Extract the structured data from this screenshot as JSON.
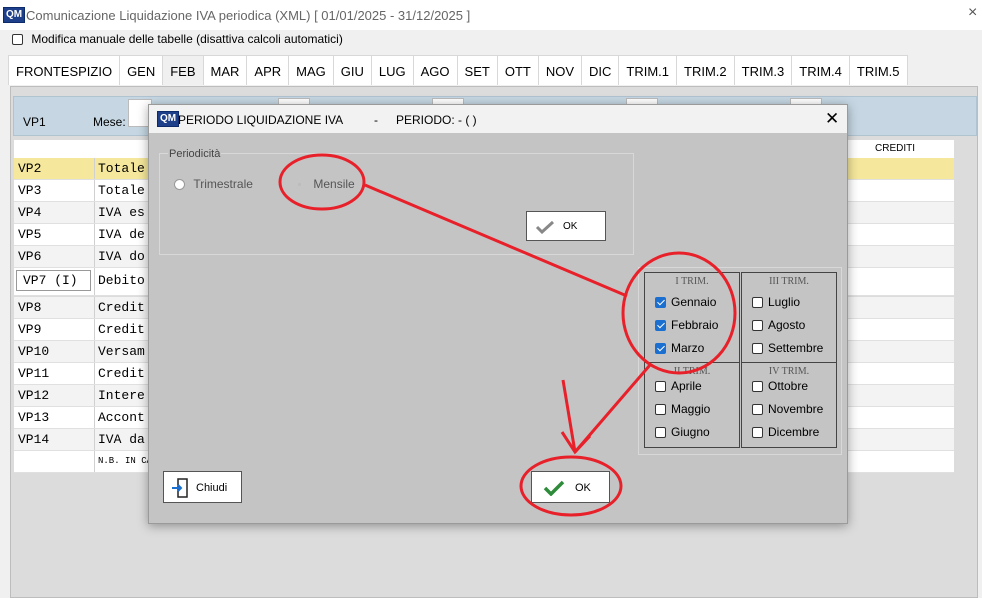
{
  "window": {
    "title": "Comunicazione Liquidazione IVA periodica (XML)  [ 01/01/2025 - 31/12/2025 ]",
    "logo": "QM",
    "close_icon": "×"
  },
  "manual_edit": {
    "label": "Modifica manuale delle tabelle (disattiva calcoli automatici)",
    "checked": false
  },
  "tabs": [
    "FRONTESPIZIO",
    "GEN",
    "FEB",
    "MAR",
    "APR",
    "MAG",
    "GIU",
    "LUG",
    "AGO",
    "SET",
    "OTT",
    "NOV",
    "DIC",
    "TRIM.1",
    "TRIM.2",
    "TRIM.3",
    "TRIM.4",
    "TRIM.5"
  ],
  "active_tab": "FEB",
  "vp1": {
    "code": "VP1",
    "mese_label": "Mese:"
  },
  "grid": {
    "crediti_header": "CREDITI",
    "rows": [
      {
        "code": "VP2",
        "desc": "Totale"
      },
      {
        "code": "VP3",
        "desc": "Totale"
      },
      {
        "code": "VP4",
        "desc": "IVA es"
      },
      {
        "code": "VP5",
        "desc": "IVA de"
      },
      {
        "code": "VP6",
        "desc": "IVA do"
      },
      {
        "code": "VP7 (I)",
        "desc": "Debito"
      },
      {
        "code": "VP8",
        "desc": "Credit"
      },
      {
        "code": "VP9",
        "desc": "Credit"
      },
      {
        "code": "VP10",
        "desc": "Versam"
      },
      {
        "code": "VP11",
        "desc": "Credit"
      },
      {
        "code": "VP12",
        "desc": "Intere"
      },
      {
        "code": "VP13",
        "desc": "Accont"
      },
      {
        "code": "VP14",
        "desc": "IVA da"
      },
      {
        "code": "",
        "desc": "N.B. IN CA"
      }
    ]
  },
  "dialog": {
    "title": "PERIODO LIQUIDAZIONE IVA",
    "dash": "-",
    "periodo": "PERIODO: -  ( )",
    "periodicita_label": "Periodicità",
    "trimestrale": "Trimestrale",
    "mensile": "Mensile",
    "selected_periodicity": "Mensile",
    "ok_small": "OK",
    "ok_main": "OK",
    "chiudi": "Chiudi",
    "quarters": [
      {
        "name": "I TRIM.",
        "months": [
          {
            "label": "Gennaio",
            "checked": true
          },
          {
            "label": "Febbraio",
            "checked": true
          },
          {
            "label": "Marzo",
            "checked": true
          }
        ]
      },
      {
        "name": "III TRIM.",
        "months": [
          {
            "label": "Luglio",
            "checked": false
          },
          {
            "label": "Agosto",
            "checked": false
          },
          {
            "label": "Settembre",
            "checked": false
          }
        ]
      },
      {
        "name": "II TRIM.",
        "months": [
          {
            "label": "Aprile",
            "checked": false
          },
          {
            "label": "Maggio",
            "checked": false
          },
          {
            "label": "Giugno",
            "checked": false
          }
        ]
      },
      {
        "name": "IV TRIM.",
        "months": [
          {
            "label": "Ottobre",
            "checked": false
          },
          {
            "label": "Novembre",
            "checked": false
          },
          {
            "label": "Dicembre",
            "checked": false
          }
        ]
      }
    ]
  },
  "colors": {
    "annotation": "#e8202a",
    "check_green": "#2e8b3a",
    "checkbox_blue": "#1a6fd1",
    "highlight_row": "#f5e79b"
  }
}
